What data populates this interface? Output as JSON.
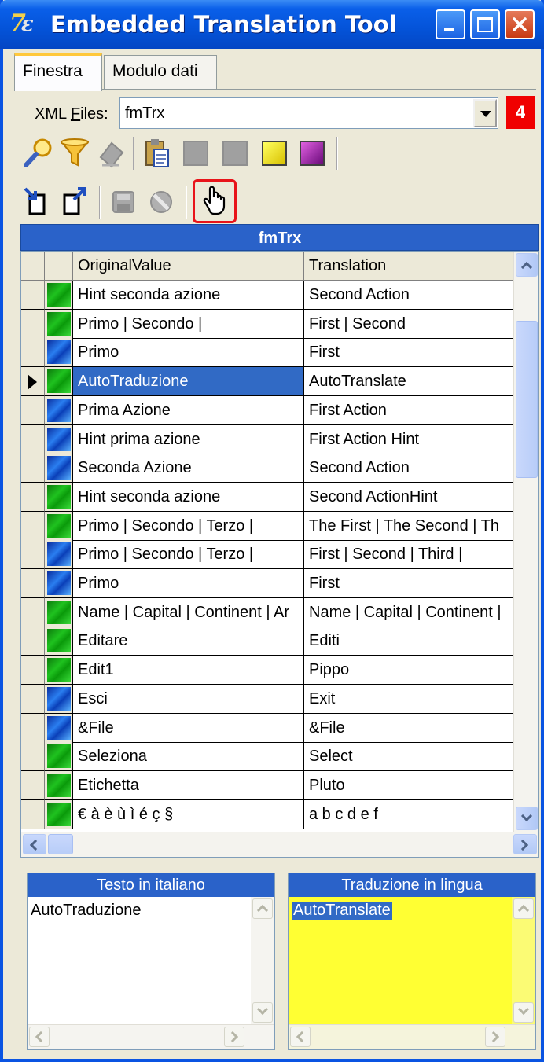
{
  "window": {
    "title": "Embedded Translation Tool",
    "icon_glyph": "7",
    "icon_glyph_small": "ε"
  },
  "tabs": [
    {
      "label": "Finestra",
      "active": true
    },
    {
      "label": "Modulo dati",
      "active": false
    }
  ],
  "xml": {
    "label_prefix": "XML ",
    "label_underlined": "F",
    "label_suffix": "iles:",
    "selected": "fmTrx",
    "count": "4"
  },
  "toolbar1": {
    "icons": [
      "search-icon",
      "filter-icon",
      "delete-icon",
      "paste-icon",
      "gray-square-icon",
      "gray-square-icon",
      "yellow-square-icon",
      "purple-square-icon"
    ]
  },
  "toolbar2": {
    "icons": [
      "import-icon",
      "export-icon",
      "save-icon",
      "cancel-icon",
      "hand-pointer-icon"
    ]
  },
  "grid": {
    "title": "fmTrx",
    "columns": {
      "original": "OriginalValue",
      "translation": "Translation"
    },
    "rows": [
      {
        "flag": "green",
        "original": "Hint seconda azione",
        "translation": "Second Action",
        "selected": false
      },
      {
        "flag": "green",
        "original": "Primo | Secondo |",
        "translation": "First | Second",
        "selected": false
      },
      {
        "flag": "blue",
        "original": "Primo",
        "translation": "First",
        "selected": false
      },
      {
        "flag": "green",
        "original": "AutoTraduzione",
        "translation": "AutoTranslate",
        "selected": true
      },
      {
        "flag": "blue",
        "original": "Prima Azione",
        "translation": "First Action",
        "selected": false
      },
      {
        "flag": "blue",
        "original": "Hint prima azione",
        "translation": "First Action Hint",
        "selected": false
      },
      {
        "flag": "blue",
        "original": "Seconda Azione",
        "translation": "Second Action",
        "selected": false
      },
      {
        "flag": "green",
        "original": "Hint seconda azione",
        "translation": "Second ActionHint",
        "selected": false
      },
      {
        "flag": "green",
        "original": "Primo | Secondo | Terzo |",
        "translation": "The First | The Second | Th",
        "selected": false
      },
      {
        "flag": "blue",
        "original": "Primo | Secondo | Terzo |",
        "translation": "First | Second | Third |",
        "selected": false
      },
      {
        "flag": "blue",
        "original": "Primo",
        "translation": "First",
        "selected": false
      },
      {
        "flag": "green",
        "original": "Name | Capital | Continent | Ar",
        "translation": "Name | Capital | Continent |",
        "selected": false
      },
      {
        "flag": "green",
        "original": "Editare",
        "translation": "Editi",
        "selected": false
      },
      {
        "flag": "green",
        "original": "Edit1",
        "translation": "Pippo",
        "selected": false
      },
      {
        "flag": "blue",
        "original": "Esci",
        "translation": "Exit",
        "selected": false
      },
      {
        "flag": "blue",
        "original": "&File",
        "translation": "&File",
        "selected": false
      },
      {
        "flag": "green",
        "original": "Seleziona",
        "translation": "Select",
        "selected": false
      },
      {
        "flag": "green",
        "original": "Etichetta",
        "translation": "Pluto",
        "selected": false
      },
      {
        "flag": "green",
        "original": "€ à è ù ì é ç §",
        "translation": "a b c d e f",
        "selected": false
      }
    ]
  },
  "panels": {
    "source": {
      "header": "Testo in italiano",
      "text": "AutoTraduzione"
    },
    "target": {
      "header": "Traduzione in lingua",
      "text": "AutoTranslate",
      "background": "#FFFF33"
    }
  },
  "colors": {
    "titlebar": "#0453D8",
    "grid_header": "#2A62C9",
    "selection": "#316AC5",
    "highlight_frame": "#E8141A",
    "badge": "#F00000"
  }
}
